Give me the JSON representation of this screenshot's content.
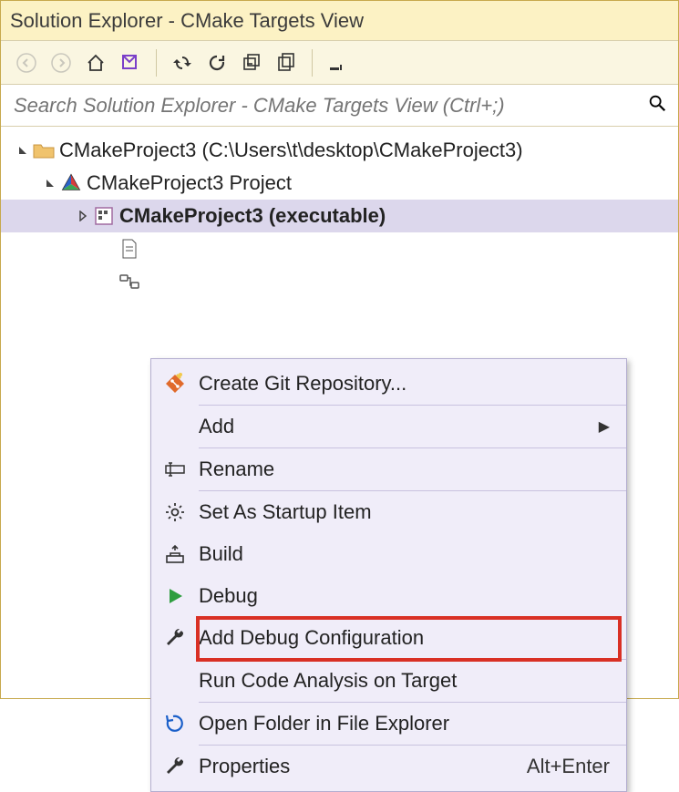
{
  "title": "Solution Explorer - CMake Targets View",
  "search": {
    "placeholder": "Search Solution Explorer - CMake Targets View (Ctrl+;)"
  },
  "tree": {
    "root": "CMakeProject3 (C:\\Users\\t\\desktop\\CMakeProject3)",
    "project": "CMakeProject3 Project",
    "target": "CMakeProject3 (executable)"
  },
  "menu": {
    "create_git": "Create Git Repository...",
    "add": "Add",
    "rename": "Rename",
    "startup": "Set As Startup Item",
    "build": "Build",
    "debug": "Debug",
    "add_debug_cfg": "Add Debug Configuration",
    "code_analysis": "Run Code Analysis on Target",
    "open_explorer": "Open Folder in File Explorer",
    "properties": "Properties",
    "properties_shortcut": "Alt+Enter"
  }
}
